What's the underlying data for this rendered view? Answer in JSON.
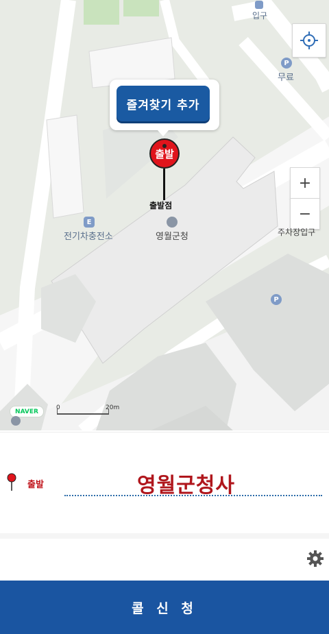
{
  "map": {
    "labels": {
      "entrance": "입구",
      "free": "무료",
      "charging_station": "전기차충전소",
      "county_office": "영월군청",
      "parking_entrance": "주차장입구",
      "start_point": "출발점"
    },
    "badges": {
      "parking": "P",
      "charging": "E"
    },
    "tooltip_button": "즐겨찾기 추가",
    "start_pin_label": "출발",
    "naver_logo": "NAVER",
    "scale": {
      "start": "0",
      "end": "20m"
    },
    "zoom_in": "+",
    "zoom_out": "−"
  },
  "panel": {
    "start_label": "출발",
    "place_name": "영월군청사"
  },
  "call_button": "콜 신 청",
  "colors": {
    "accent_blue": "#1a55a1",
    "pin_red": "#e0141c",
    "text_red": "#b0161c"
  },
  "icons": [
    "location-crosshair-icon",
    "parking-icon",
    "ev-charging-icon",
    "government-building-icon",
    "map-pin-icon",
    "gear-icon"
  ]
}
